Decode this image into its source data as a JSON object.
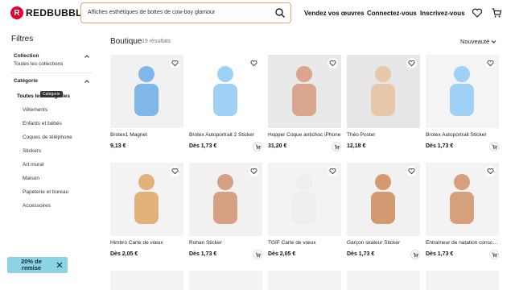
{
  "brand": {
    "logo_text": "REDBUBBLE",
    "accent": "#e4002b"
  },
  "search": {
    "value": "Affiches esthétiques de bottes de cow-boy glamour"
  },
  "nav": {
    "sell": "Vendez vos œuvres",
    "login": "Connectez-vous",
    "signup": "Inscrivez-vous"
  },
  "sidebar": {
    "title": "Filtres",
    "collection_heading": "Collection",
    "collection_link": "Toutes les collections",
    "category_heading": "Catégorie",
    "all_categories": "Toutes les catégories",
    "tooltip": "Catégorie",
    "subcategories": [
      "Vêtements",
      "Enfants et bébés",
      "Coques de téléphone",
      "Stickers",
      "Art mural",
      "Maison",
      "Papeterie et bureau",
      "Accessoires"
    ]
  },
  "promo": {
    "text": "20% de remise",
    "bg": "#8dd3e6"
  },
  "main": {
    "title": "Boutique",
    "count": "19 résultats",
    "sort": "Nouveauté"
  },
  "products": [
    {
      "title": "Brotex1 Magnet",
      "price": "9,13 €",
      "cart": false
    },
    {
      "title": "Brotex Autoportrait 2 Sticker",
      "price": "Dès 1,73 €",
      "cart": true
    },
    {
      "title": "Hopper Coque antichoc iPhone",
      "price": "31,20 €",
      "cart": true
    },
    {
      "title": "Théo Poster",
      "price": "12,18 €",
      "cart": false
    },
    {
      "title": "Brotex Autoportrait Sticker",
      "price": "Dès 1,73 €",
      "cart": true
    },
    {
      "title": "Himbro Carte de vœux",
      "price": "Dès 2,05 €",
      "cart": false
    },
    {
      "title": "Rohan Sticker",
      "price": "Dès 1,73 €",
      "cart": true
    },
    {
      "title": "TGIF Carte de vœux",
      "price": "Dès 2,05 €",
      "cart": false
    },
    {
      "title": "Garçon skateur Sticker",
      "price": "Dès 1,73 €",
      "cart": true
    },
    {
      "title": "Entraîneur de natation conscie...",
      "price": "Dès 1,73 €",
      "cart": true
    }
  ]
}
